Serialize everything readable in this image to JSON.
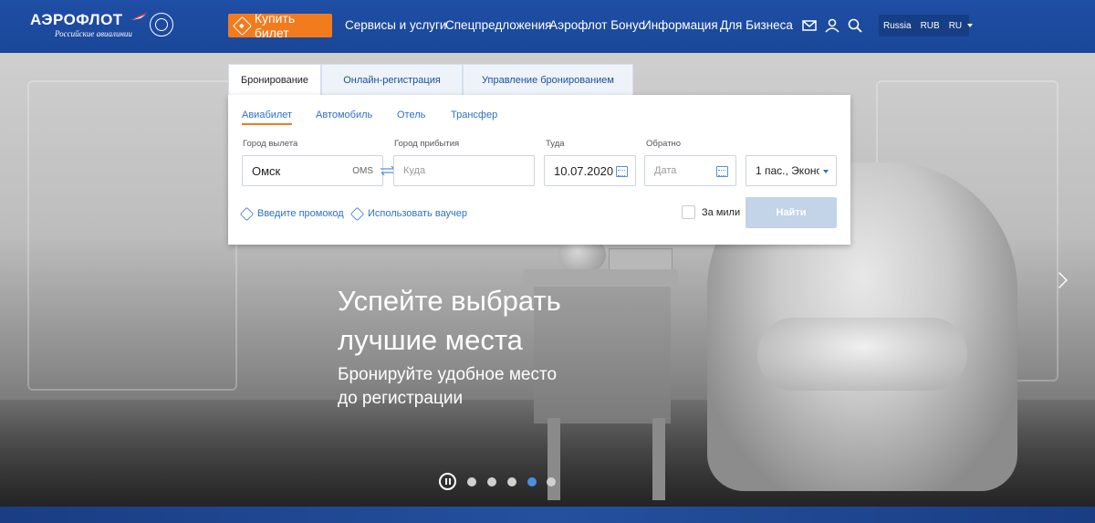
{
  "header": {
    "logo": {
      "name": "АЭРОФЛОТ",
      "subtitle": "Российские авиалинии"
    },
    "buy_ticket": "Купить билет",
    "nav": [
      "Сервисы и услуги",
      "Спецпредложения",
      "Аэрофлот Бонус",
      "Информация",
      "Для Бизнеса"
    ],
    "icons": [
      "mail-icon",
      "user-icon",
      "search-icon"
    ],
    "locale": {
      "country": "Russia",
      "currency": "RUB",
      "language": "RU"
    }
  },
  "booking": {
    "tabs": [
      "Бронирование",
      "Онлайн-регистрация",
      "Управление бронированием"
    ],
    "active_tab": "Бронирование",
    "subtabs": [
      "Авиабилет",
      "Автомобиль",
      "Отель",
      "Трансфер"
    ],
    "active_subtab": "Авиабилет",
    "from": {
      "label": "Город вылета",
      "value": "Омск",
      "code": "OMS"
    },
    "to": {
      "label": "Город прибытия",
      "placeholder": "Куда"
    },
    "depart": {
      "label": "Туда",
      "value": "10.07.2020"
    },
    "return": {
      "label": "Обратно",
      "placeholder": "Дата"
    },
    "passengers": "1 пас., Эконо",
    "promo": "Введите промокод",
    "voucher": "Использовать ваучер",
    "miles_label": "За мили",
    "find": "Найти"
  },
  "hero": {
    "title_line1": "Успейте выбрать",
    "title_line2": "лучшие места",
    "sub_line1": "Бронируйте удобное место",
    "sub_line2": "до регистрации",
    "slides": 5,
    "active_slide": 4
  },
  "colors": {
    "header": "#1e4ea5",
    "accent": "#f27b1e",
    "link": "#2f6fc9",
    "button_disabled": "#c3d3e8"
  }
}
